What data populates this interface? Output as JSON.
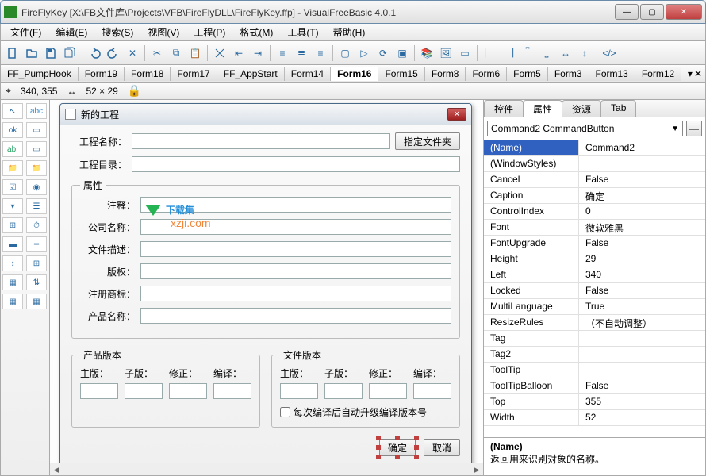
{
  "window": {
    "title": "FireFlyKey [X:\\FB文件库\\Projects\\VFB\\FireFlyDLL\\FireFlyKey.ffp] - VisualFreeBasic 4.0.1"
  },
  "menu": [
    "文件(F)",
    "编辑(E)",
    "搜索(S)",
    "视图(V)",
    "工程(P)",
    "格式(M)",
    "工具(T)",
    "帮助(H)"
  ],
  "docTabs": [
    "FF_PumpHook",
    "Form19",
    "Form18",
    "Form17",
    "FF_AppStart",
    "Form14",
    "Form16",
    "Form15",
    "Form8",
    "Form6",
    "Form5",
    "Form3",
    "Form13",
    "Form12"
  ],
  "docTabActive": "Form16",
  "status": {
    "pos": "340, 355",
    "size": "52 × 29"
  },
  "dialog": {
    "title": "新的工程",
    "labels": {
      "projName": "工程名称：",
      "projDir": "工程目录：",
      "attrs": "属性",
      "comment": "注释：",
      "company": "公司名称：",
      "fileDesc": "文件描述：",
      "copyright": "版权：",
      "trademark": "注册商标：",
      "product": "产品名称："
    },
    "browseBtn": "指定文件夹",
    "productVersion": {
      "legend": "产品版本",
      "cols": [
        "主版：",
        "子版：",
        "修正：",
        "编译："
      ]
    },
    "fileVersion": {
      "legend": "文件版本",
      "cols": [
        "主版：",
        "子版：",
        "修正：",
        "编译："
      ]
    },
    "autoCheckbox": "每次编译后自动升级编译版本号",
    "ok": "确定",
    "cancel": "取消"
  },
  "rightPanel": {
    "tabs": [
      "控件",
      "属性",
      "资源",
      "Tab"
    ],
    "activeTab": "属性",
    "combo": "Command2 CommandButton",
    "props": [
      {
        "name": "(Name)",
        "value": "Command2",
        "selected": true
      },
      {
        "name": "(WindowStyles)",
        "value": ""
      },
      {
        "name": "Cancel",
        "value": "False"
      },
      {
        "name": "Caption",
        "value": "确定"
      },
      {
        "name": "ControlIndex",
        "value": "0"
      },
      {
        "name": "Font",
        "value": "微软雅黑"
      },
      {
        "name": "FontUpgrade",
        "value": "False"
      },
      {
        "name": "Height",
        "value": "29"
      },
      {
        "name": "Left",
        "value": "340"
      },
      {
        "name": "Locked",
        "value": "False"
      },
      {
        "name": "MultiLanguage",
        "value": "True"
      },
      {
        "name": "ResizeRules",
        "value": "（不自动调整）"
      },
      {
        "name": "Tag",
        "value": ""
      },
      {
        "name": "Tag2",
        "value": ""
      },
      {
        "name": "ToolTip",
        "value": ""
      },
      {
        "name": "ToolTipBalloon",
        "value": "False"
      },
      {
        "name": "Top",
        "value": "355"
      },
      {
        "name": "Width",
        "value": "52"
      }
    ],
    "descTitle": "(Name)",
    "descText": "返回用来识别对象的名称。"
  },
  "watermark": {
    "top": "下载集",
    "sub": "xzji.com"
  }
}
